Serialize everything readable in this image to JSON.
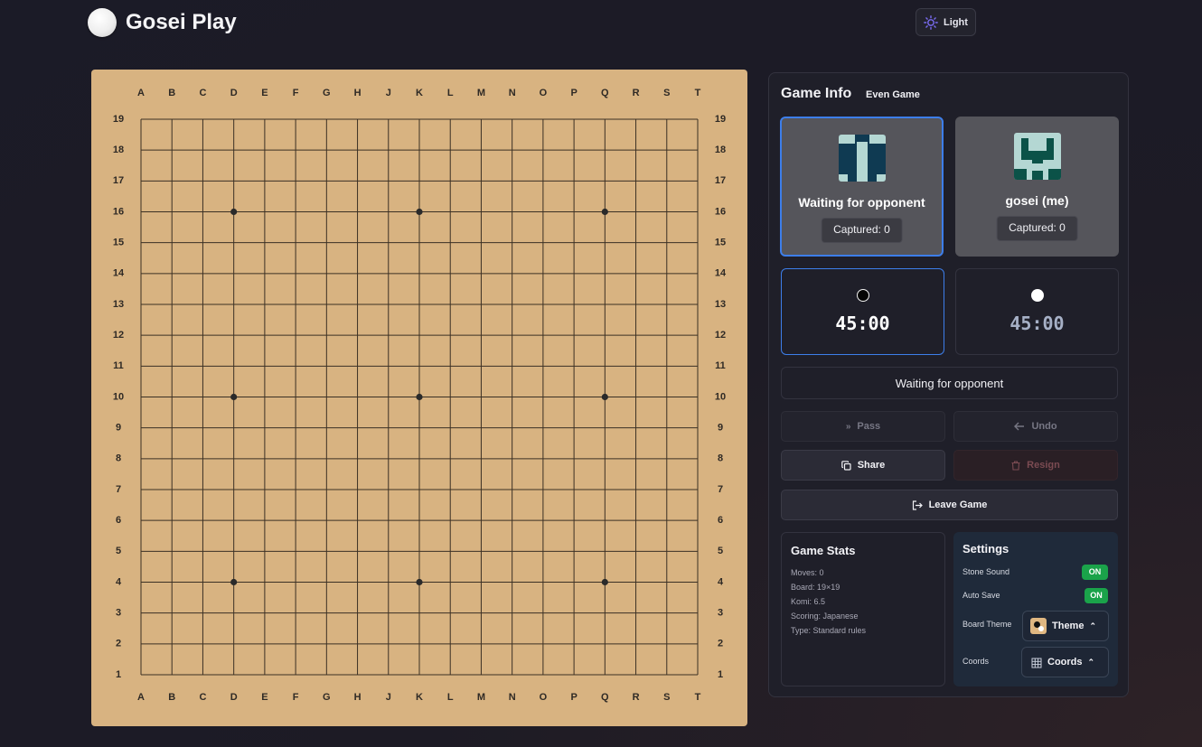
{
  "header": {
    "app_title": "Gosei Play",
    "theme_label": "Light"
  },
  "board": {
    "size": 19,
    "col_labels": [
      "A",
      "B",
      "C",
      "D",
      "E",
      "F",
      "G",
      "H",
      "J",
      "K",
      "L",
      "M",
      "N",
      "O",
      "P",
      "Q",
      "R",
      "S",
      "T"
    ],
    "row_labels": [
      "19",
      "18",
      "17",
      "16",
      "15",
      "14",
      "13",
      "12",
      "11",
      "10",
      "9",
      "8",
      "7",
      "6",
      "5",
      "4",
      "3",
      "2",
      "1"
    ],
    "star_points": [
      "D16",
      "K16",
      "Q16",
      "D10",
      "K10",
      "Q10",
      "D4",
      "K4",
      "Q4"
    ],
    "colors": {
      "wood": "#d8b381",
      "line": "#3b3024",
      "label": "#2f2a25"
    }
  },
  "game_info": {
    "title": "Game Info",
    "mode_badge": "Even Game",
    "players": [
      {
        "name": "Waiting for opponent",
        "captured": "Captured: 0",
        "active": true
      },
      {
        "name": "gosei (me)",
        "captured": "Captured: 0",
        "active": false
      }
    ],
    "clocks": [
      {
        "stone": "black",
        "time": "45:00",
        "active": true
      },
      {
        "stone": "white",
        "time": "45:00",
        "active": false
      }
    ],
    "status": "Waiting for opponent"
  },
  "actions": {
    "pass": "Pass",
    "undo": "Undo",
    "share": "Share",
    "resign": "Resign",
    "leave": "Leave Game"
  },
  "stats": {
    "title": "Game Stats",
    "moves": "Moves: 0",
    "board": "Board: 19×19",
    "komi": "Komi: 6.5",
    "scoring": "Scoring: Japanese",
    "type": "Type: Standard rules"
  },
  "settings": {
    "title": "Settings",
    "stone_sound": {
      "label": "Stone Sound",
      "value": "ON"
    },
    "auto_save": {
      "label": "Auto Save",
      "value": "ON"
    },
    "board_theme": {
      "label": "Board Theme",
      "button": "Theme"
    },
    "coords": {
      "label": "Coords",
      "button": "Coords"
    }
  },
  "accent_colors": {
    "primary": "#3d7eea",
    "toggle_on": "#1aa34a"
  }
}
